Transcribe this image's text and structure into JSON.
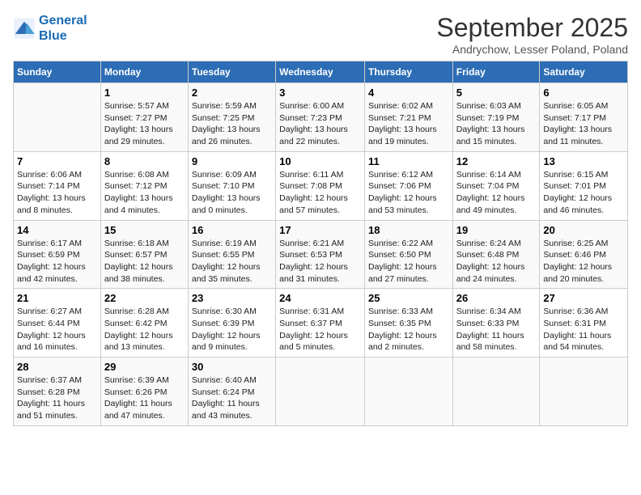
{
  "logo": {
    "line1": "General",
    "line2": "Blue"
  },
  "title": "September 2025",
  "subtitle": "Andrychow, Lesser Poland, Poland",
  "days_header": [
    "Sunday",
    "Monday",
    "Tuesday",
    "Wednesday",
    "Thursday",
    "Friday",
    "Saturday"
  ],
  "weeks": [
    [
      {
        "num": "",
        "text": ""
      },
      {
        "num": "1",
        "text": "Sunrise: 5:57 AM\nSunset: 7:27 PM\nDaylight: 13 hours\nand 29 minutes."
      },
      {
        "num": "2",
        "text": "Sunrise: 5:59 AM\nSunset: 7:25 PM\nDaylight: 13 hours\nand 26 minutes."
      },
      {
        "num": "3",
        "text": "Sunrise: 6:00 AM\nSunset: 7:23 PM\nDaylight: 13 hours\nand 22 minutes."
      },
      {
        "num": "4",
        "text": "Sunrise: 6:02 AM\nSunset: 7:21 PM\nDaylight: 13 hours\nand 19 minutes."
      },
      {
        "num": "5",
        "text": "Sunrise: 6:03 AM\nSunset: 7:19 PM\nDaylight: 13 hours\nand 15 minutes."
      },
      {
        "num": "6",
        "text": "Sunrise: 6:05 AM\nSunset: 7:17 PM\nDaylight: 13 hours\nand 11 minutes."
      }
    ],
    [
      {
        "num": "7",
        "text": "Sunrise: 6:06 AM\nSunset: 7:14 PM\nDaylight: 13 hours\nand 8 minutes."
      },
      {
        "num": "8",
        "text": "Sunrise: 6:08 AM\nSunset: 7:12 PM\nDaylight: 13 hours\nand 4 minutes."
      },
      {
        "num": "9",
        "text": "Sunrise: 6:09 AM\nSunset: 7:10 PM\nDaylight: 13 hours\nand 0 minutes."
      },
      {
        "num": "10",
        "text": "Sunrise: 6:11 AM\nSunset: 7:08 PM\nDaylight: 12 hours\nand 57 minutes."
      },
      {
        "num": "11",
        "text": "Sunrise: 6:12 AM\nSunset: 7:06 PM\nDaylight: 12 hours\nand 53 minutes."
      },
      {
        "num": "12",
        "text": "Sunrise: 6:14 AM\nSunset: 7:04 PM\nDaylight: 12 hours\nand 49 minutes."
      },
      {
        "num": "13",
        "text": "Sunrise: 6:15 AM\nSunset: 7:01 PM\nDaylight: 12 hours\nand 46 minutes."
      }
    ],
    [
      {
        "num": "14",
        "text": "Sunrise: 6:17 AM\nSunset: 6:59 PM\nDaylight: 12 hours\nand 42 minutes."
      },
      {
        "num": "15",
        "text": "Sunrise: 6:18 AM\nSunset: 6:57 PM\nDaylight: 12 hours\nand 38 minutes."
      },
      {
        "num": "16",
        "text": "Sunrise: 6:19 AM\nSunset: 6:55 PM\nDaylight: 12 hours\nand 35 minutes."
      },
      {
        "num": "17",
        "text": "Sunrise: 6:21 AM\nSunset: 6:53 PM\nDaylight: 12 hours\nand 31 minutes."
      },
      {
        "num": "18",
        "text": "Sunrise: 6:22 AM\nSunset: 6:50 PM\nDaylight: 12 hours\nand 27 minutes."
      },
      {
        "num": "19",
        "text": "Sunrise: 6:24 AM\nSunset: 6:48 PM\nDaylight: 12 hours\nand 24 minutes."
      },
      {
        "num": "20",
        "text": "Sunrise: 6:25 AM\nSunset: 6:46 PM\nDaylight: 12 hours\nand 20 minutes."
      }
    ],
    [
      {
        "num": "21",
        "text": "Sunrise: 6:27 AM\nSunset: 6:44 PM\nDaylight: 12 hours\nand 16 minutes."
      },
      {
        "num": "22",
        "text": "Sunrise: 6:28 AM\nSunset: 6:42 PM\nDaylight: 12 hours\nand 13 minutes."
      },
      {
        "num": "23",
        "text": "Sunrise: 6:30 AM\nSunset: 6:39 PM\nDaylight: 12 hours\nand 9 minutes."
      },
      {
        "num": "24",
        "text": "Sunrise: 6:31 AM\nSunset: 6:37 PM\nDaylight: 12 hours\nand 5 minutes."
      },
      {
        "num": "25",
        "text": "Sunrise: 6:33 AM\nSunset: 6:35 PM\nDaylight: 12 hours\nand 2 minutes."
      },
      {
        "num": "26",
        "text": "Sunrise: 6:34 AM\nSunset: 6:33 PM\nDaylight: 11 hours\nand 58 minutes."
      },
      {
        "num": "27",
        "text": "Sunrise: 6:36 AM\nSunset: 6:31 PM\nDaylight: 11 hours\nand 54 minutes."
      }
    ],
    [
      {
        "num": "28",
        "text": "Sunrise: 6:37 AM\nSunset: 6:28 PM\nDaylight: 11 hours\nand 51 minutes."
      },
      {
        "num": "29",
        "text": "Sunrise: 6:39 AM\nSunset: 6:26 PM\nDaylight: 11 hours\nand 47 minutes."
      },
      {
        "num": "30",
        "text": "Sunrise: 6:40 AM\nSunset: 6:24 PM\nDaylight: 11 hours\nand 43 minutes."
      },
      {
        "num": "",
        "text": ""
      },
      {
        "num": "",
        "text": ""
      },
      {
        "num": "",
        "text": ""
      },
      {
        "num": "",
        "text": ""
      }
    ]
  ]
}
